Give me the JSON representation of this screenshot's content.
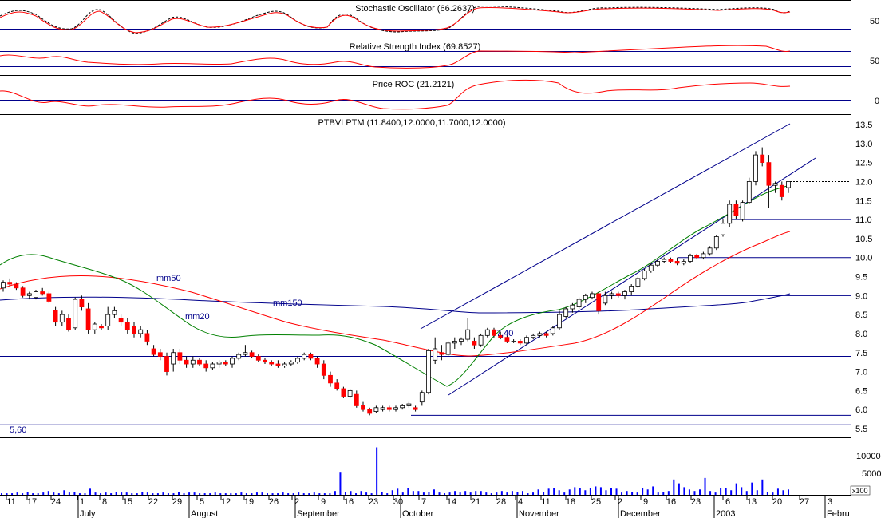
{
  "chart_data": {
    "type": "candlestick",
    "panels": {
      "stoch": {
        "label": "Stochastic Oscillator (66.2637)",
        "ticks": [
          "50"
        ]
      },
      "rsi": {
        "label": "Relative Strength Index (69.8527)",
        "ticks": [
          "50"
        ]
      },
      "roc": {
        "label": "Price ROC (21.2121)",
        "ticks": [
          "0"
        ]
      },
      "price": {
        "label": "PTBVLPTM (11.8400,12.0000,11.7000,12.0000)",
        "ylim": [
          5.4,
          13.7
        ],
        "ticks": [
          "13.5",
          "13.0",
          "12.5",
          "12.0",
          "11.5",
          "11.0",
          "10.5",
          "10.0",
          "9.5",
          "9.0",
          "8.5",
          "8.0",
          "7.5",
          "7.0",
          "6.5",
          "6.0",
          "5.5"
        ],
        "annotations": {
          "mm50": "mm50",
          "mm150": "mm150",
          "mm20": "mm20",
          "support1": "7,40",
          "support2": "5,60"
        },
        "hlines": [
          11.0,
          10.0,
          9.0,
          7.4,
          5.85,
          5.6
        ],
        "moving_average_colors": {
          "mm20": "#008000",
          "mm50": "#ff0000",
          "mm150": "#00008b"
        }
      },
      "volume": {
        "ticks": [
          "10000",
          "5000"
        ],
        "unit": "x100"
      }
    },
    "x_ticks": [
      "11",
      "17",
      "24",
      "1",
      "8",
      "15",
      "22",
      "29",
      "5",
      "12",
      "19",
      "26",
      "2",
      "9",
      "16",
      "23",
      "30",
      "7",
      "14",
      "21",
      "28",
      "4",
      "11",
      "18",
      "25",
      "2",
      "9",
      "16",
      "23",
      "6",
      "13",
      "20",
      "27",
      "3"
    ],
    "months": [
      "July",
      "August",
      "September",
      "October",
      "November",
      "December",
      "2003",
      "Febru"
    ],
    "candles": [
      [
        9.2,
        9.4,
        9.1,
        9.35
      ],
      [
        9.35,
        9.45,
        9.25,
        9.3
      ],
      [
        9.3,
        9.35,
        9.15,
        9.2
      ],
      [
        9.2,
        9.25,
        8.95,
        9.0
      ],
      [
        9.0,
        9.1,
        8.9,
        9.05
      ],
      [
        8.95,
        9.15,
        8.9,
        9.1
      ],
      [
        9.1,
        9.2,
        9.0,
        9.05
      ],
      [
        9.05,
        9.1,
        8.8,
        8.85
      ],
      [
        8.6,
        8.7,
        8.2,
        8.3
      ],
      [
        8.3,
        8.6,
        8.2,
        8.5
      ],
      [
        8.4,
        8.5,
        8.05,
        8.1
      ],
      [
        8.15,
        8.95,
        8.1,
        8.9
      ],
      [
        8.9,
        9.0,
        8.6,
        8.7
      ],
      [
        8.65,
        8.8,
        8.0,
        8.1
      ],
      [
        8.1,
        8.3,
        8.0,
        8.25
      ],
      [
        8.2,
        8.25,
        8.1,
        8.15
      ],
      [
        8.2,
        8.7,
        8.1,
        8.5
      ],
      [
        8.5,
        8.7,
        8.4,
        8.6
      ],
      [
        8.4,
        8.5,
        8.2,
        8.3
      ],
      [
        8.3,
        8.4,
        8.0,
        8.1
      ],
      [
        8.2,
        8.3,
        7.9,
        8.0
      ],
      [
        8.0,
        8.2,
        7.9,
        8.1
      ],
      [
        8.0,
        8.1,
        7.7,
        7.8
      ],
      [
        7.6,
        7.7,
        7.4,
        7.45
      ],
      [
        7.5,
        7.6,
        7.3,
        7.4
      ],
      [
        7.4,
        7.5,
        6.9,
        7.0
      ],
      [
        7.2,
        7.6,
        7.0,
        7.5
      ],
      [
        7.5,
        7.6,
        7.2,
        7.3
      ],
      [
        7.3,
        7.4,
        7.1,
        7.2
      ],
      [
        7.2,
        7.4,
        7.1,
        7.3
      ],
      [
        7.3,
        7.35,
        7.15,
        7.2
      ],
      [
        7.2,
        7.3,
        7.0,
        7.1
      ],
      [
        7.1,
        7.25,
        7.05,
        7.2
      ],
      [
        7.2,
        7.3,
        7.1,
        7.25
      ],
      [
        7.25,
        7.3,
        7.15,
        7.2
      ],
      [
        7.2,
        7.4,
        7.1,
        7.35
      ],
      [
        7.35,
        7.5,
        7.3,
        7.45
      ],
      [
        7.45,
        7.7,
        7.4,
        7.5
      ],
      [
        7.5,
        7.55,
        7.35,
        7.4
      ],
      [
        7.4,
        7.45,
        7.25,
        7.3
      ],
      [
        7.3,
        7.35,
        7.2,
        7.25
      ],
      [
        7.25,
        7.3,
        7.15,
        7.2
      ],
      [
        7.2,
        7.3,
        7.1,
        7.15
      ],
      [
        7.15,
        7.25,
        7.1,
        7.2
      ],
      [
        7.2,
        7.3,
        7.15,
        7.25
      ],
      [
        7.25,
        7.4,
        7.2,
        7.35
      ],
      [
        7.35,
        7.5,
        7.3,
        7.45
      ],
      [
        7.45,
        7.5,
        7.3,
        7.35
      ],
      [
        7.35,
        7.4,
        7.1,
        7.2
      ],
      [
        7.2,
        7.3,
        6.8,
        6.9
      ],
      [
        6.9,
        7.0,
        6.6,
        6.7
      ],
      [
        6.7,
        6.8,
        6.5,
        6.55
      ],
      [
        6.55,
        6.6,
        6.3,
        6.35
      ],
      [
        6.35,
        6.55,
        6.3,
        6.5
      ],
      [
        6.4,
        6.5,
        6.05,
        6.1
      ],
      [
        6.1,
        6.2,
        5.95,
        6.0
      ],
      [
        6.0,
        6.05,
        5.85,
        5.9
      ],
      [
        5.95,
        6.1,
        5.9,
        6.05
      ],
      [
        6.0,
        6.1,
        5.95,
        6.05
      ],
      [
        6.05,
        6.1,
        5.95,
        6.0
      ],
      [
        6.0,
        6.1,
        5.95,
        6.05
      ],
      [
        6.05,
        6.15,
        6.0,
        6.1
      ],
      [
        6.1,
        6.2,
        6.05,
        6.15
      ],
      [
        6.05,
        6.1,
        5.95,
        6.0
      ],
      [
        6.2,
        6.5,
        6.1,
        6.45
      ],
      [
        6.45,
        7.6,
        6.4,
        7.55
      ],
      [
        7.3,
        7.9,
        7.2,
        7.6
      ],
      [
        7.5,
        7.7,
        7.3,
        7.45
      ],
      [
        7.45,
        7.8,
        7.4,
        7.75
      ],
      [
        7.75,
        7.9,
        7.6,
        7.8
      ],
      [
        7.8,
        7.9,
        7.7,
        7.85
      ],
      [
        7.85,
        8.4,
        7.8,
        8.1
      ],
      [
        7.8,
        7.9,
        7.6,
        7.7
      ],
      [
        7.7,
        8.0,
        7.65,
        7.95
      ],
      [
        7.95,
        8.15,
        7.9,
        8.1
      ],
      [
        8.1,
        8.15,
        7.9,
        7.95
      ],
      [
        7.95,
        8.05,
        7.85,
        7.9
      ],
      [
        7.9,
        7.95,
        7.75,
        7.8
      ],
      [
        7.8,
        7.85,
        7.75,
        7.8
      ],
      [
        7.8,
        7.85,
        7.7,
        7.75
      ],
      [
        7.75,
        7.95,
        7.7,
        7.9
      ],
      [
        7.9,
        8.0,
        7.85,
        7.95
      ],
      [
        7.95,
        8.05,
        7.9,
        8.0
      ],
      [
        8.0,
        8.05,
        7.9,
        7.95
      ],
      [
        8.0,
        8.2,
        7.95,
        8.15
      ],
      [
        8.15,
        8.6,
        8.1,
        8.5
      ],
      [
        8.45,
        8.7,
        8.4,
        8.65
      ],
      [
        8.65,
        8.8,
        8.55,
        8.75
      ],
      [
        8.7,
        8.95,
        8.65,
        8.9
      ],
      [
        8.9,
        9.05,
        8.8,
        9.0
      ],
      [
        8.95,
        9.1,
        8.9,
        9.05
      ],
      [
        9.05,
        9.1,
        8.5,
        8.6
      ],
      [
        8.8,
        9.1,
        8.75,
        9.0
      ],
      [
        9.0,
        9.1,
        8.9,
        9.05
      ],
      [
        9.05,
        9.1,
        8.95,
        9.0
      ],
      [
        9.0,
        9.15,
        8.9,
        9.1
      ],
      [
        9.1,
        9.3,
        9.0,
        9.25
      ],
      [
        9.25,
        9.5,
        9.2,
        9.45
      ],
      [
        9.45,
        9.7,
        9.4,
        9.65
      ],
      [
        9.65,
        9.85,
        9.6,
        9.8
      ],
      [
        9.8,
        9.95,
        9.75,
        9.9
      ],
      [
        9.9,
        10.0,
        9.85,
        9.95
      ],
      [
        9.95,
        10.0,
        9.85,
        9.9
      ],
      [
        9.9,
        10.0,
        9.8,
        9.85
      ],
      [
        9.85,
        9.95,
        9.8,
        9.9
      ],
      [
        9.9,
        10.1,
        9.85,
        10.05
      ],
      [
        10.05,
        10.1,
        9.95,
        10.0
      ],
      [
        10.0,
        10.15,
        9.95,
        10.1
      ],
      [
        10.1,
        10.3,
        10.05,
        10.25
      ],
      [
        10.25,
        10.6,
        10.2,
        10.55
      ],
      [
        10.6,
        11.0,
        10.55,
        10.9
      ],
      [
        10.9,
        11.5,
        10.8,
        11.4
      ],
      [
        11.4,
        11.5,
        11.0,
        11.1
      ],
      [
        11.0,
        11.5,
        10.95,
        11.45
      ],
      [
        11.45,
        12.1,
        11.4,
        12.0
      ],
      [
        12.0,
        12.8,
        11.9,
        12.7
      ],
      [
        12.7,
        12.9,
        12.4,
        12.5
      ],
      [
        12.5,
        12.7,
        11.3,
        11.9
      ],
      [
        11.9,
        12.0,
        11.7,
        11.95
      ],
      [
        11.9,
        12.0,
        11.5,
        11.6
      ],
      [
        11.84,
        12.0,
        11.7,
        12.0
      ]
    ],
    "volume_bars": [
      2,
      2,
      2,
      3,
      2,
      4,
      2,
      2,
      3,
      5,
      3,
      2,
      6,
      3,
      4,
      2,
      2,
      8,
      3,
      2,
      3,
      2,
      4,
      3,
      3,
      2,
      2,
      4,
      3,
      2,
      2,
      3,
      2,
      2,
      4,
      2,
      3,
      3,
      2,
      2,
      2,
      3,
      2,
      2,
      2,
      2,
      3,
      2,
      2,
      3,
      3,
      2,
      2,
      2,
      3,
      2,
      2,
      3,
      2,
      2,
      3,
      2,
      2,
      2,
      5,
      30,
      4,
      5,
      2,
      5,
      3,
      2,
      62,
      4,
      2,
      6,
      8,
      3,
      9,
      5,
      5,
      3,
      4,
      7,
      3,
      2,
      3,
      5,
      3,
      5,
      3,
      5,
      5,
      3,
      2,
      3,
      5,
      3,
      5,
      4,
      5,
      2,
      3,
      7,
      4,
      8,
      9,
      6,
      3,
      7,
      10,
      9,
      6,
      9,
      11,
      10,
      6,
      9,
      8,
      3,
      5,
      4,
      3,
      9,
      7,
      11,
      3,
      4,
      5,
      20,
      15,
      10,
      7,
      5,
      7,
      22,
      5,
      3,
      9,
      9,
      6,
      15,
      10,
      5,
      16,
      6,
      20,
      4,
      3,
      8,
      6,
      7
    ]
  }
}
